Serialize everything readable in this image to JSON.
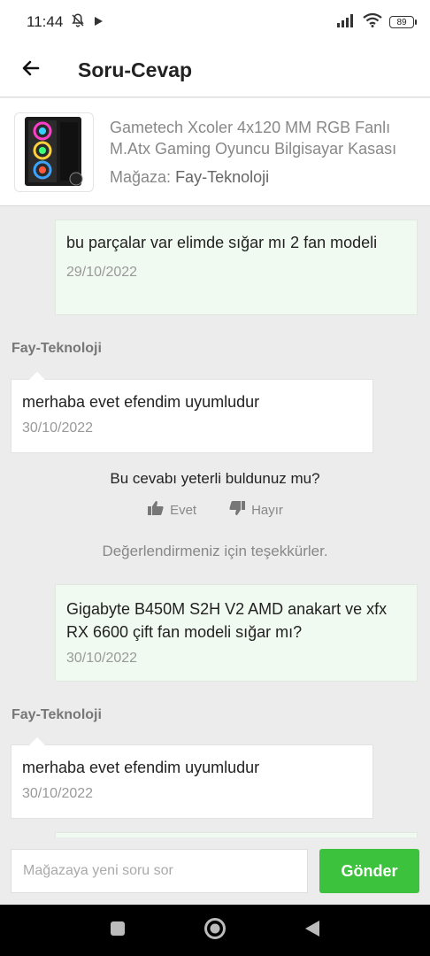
{
  "status_bar": {
    "time": "11:44",
    "battery": "89"
  },
  "app_bar": {
    "title": "Soru-Cevap"
  },
  "product": {
    "name": "Gametech Xcoler 4x120 MM RGB Fanlı M.Atx Gaming Oyuncu Bilgisayar Kasası",
    "store_label": "Mağaza:",
    "store_name": "Fay-Teknoloji"
  },
  "thread": [
    {
      "type": "question",
      "text": "bu parçalar var elimde sığar mı 2 fan modeli",
      "date": "29/10/2022"
    },
    {
      "type": "answer",
      "seller": "Fay-Teknoloji",
      "text": "merhaba evet efendim uyumludur",
      "date": "30/10/2022"
    },
    {
      "type": "question",
      "text": "Gigabyte B450M S2H V2 AMD anakart ve xfx RX 6600 çift fan modeli sığar mı?",
      "date": "30/10/2022"
    },
    {
      "type": "answer",
      "seller": "Fay-Teknoloji",
      "text": "merhaba evet efendim uyumludur",
      "date": "30/10/2022"
    }
  ],
  "feedback": {
    "question": "Bu cevabı yeterli buldunuz mu?",
    "yes_label": "Evet",
    "no_label": "Hayır",
    "thanks": "Değerlendirmeniz için teşekkürler."
  },
  "compose": {
    "placeholder": "Mağazaya yeni soru sor",
    "send_label": "Gönder"
  },
  "colors": {
    "accent": "#3cc23c",
    "question_bg": "#f1faf1"
  },
  "icons": [
    "back-arrow-icon",
    "do-not-disturb-icon",
    "play-icon",
    "signal-icon",
    "wifi-icon",
    "thumbs-up-icon",
    "thumbs-down-icon"
  ]
}
